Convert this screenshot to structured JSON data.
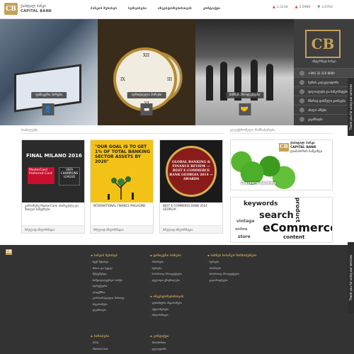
{
  "header": {
    "logo": {
      "mark": "CB",
      "line1": "ქაპიტალ ბანკი",
      "line2": "CAPITAL BANK"
    },
    "nav": [
      "ბანკის შესახებ",
      "სერვისები",
      "ინვესტორებისთვის",
      "კონტაქტი"
    ],
    "rates": [
      {
        "arrow": "▲",
        "dir": "up",
        "value": "2.3134"
      },
      {
        "arrow": "▲",
        "dir": "up",
        "value": "2.5989"
      },
      {
        "arrow": "▼",
        "dir": "down",
        "value": "3.0703"
      }
    ]
  },
  "hero": {
    "panels": [
      {
        "label": "ფიზიკური პირები",
        "icon": "👤"
      },
      {
        "label": "იურიდიული პირები",
        "icon": "▬"
      },
      {
        "label": "ბიზნეს პროდუქტები",
        "icon": "🤝"
      }
    ],
    "clock_numbers": [
      "XII",
      "III",
      "VI",
      "IX"
    ],
    "side": {
      "mark": "CB",
      "title": "ინტერნეტ ბანკი",
      "items": [
        "+995 32 210 8000",
        "სესხის კალკულატორი",
        "ფილიალები და ბანკომატები",
        "ხშირად დასმული კითხვები",
        "ახალი ამბები",
        "ვაკანსიები"
      ]
    }
  },
  "feedback": {
    "label": "Thank you for using our services",
    "top_label": "feedback"
  },
  "content": {
    "news_title": "სიახლეები",
    "partners_title": "ელექტრონული მომსახურება",
    "cards": [
      {
        "caption": "გამოიწერე MasterCard, ისარგებლე და მიიღეთ საჩუქრები",
        "more": "სრულად ინფორმაცია",
        "final_milano": "FINAL MILANO 2016",
        "mastercard": "MasterCard",
        "preferred": "Preferred Card",
        "champions": "UEFA CHAMPIONS LEAGUE"
      },
      {
        "caption": "INTERNATIONAL FINANCE MAGAZINE",
        "more": "სრულად ინფორმაცია",
        "quote": "\"OUR GOAL IS TO GET 1% OF TOTAL BANKING SECTOR ASSETS BY 2020\""
      },
      {
        "caption": "BEST E-COMMERCE BANK 2014 GEORGIA",
        "more": "სრულად ინფორმაცია",
        "seal": "GLOBAL BANKING & FINANCE REVIEW — BEST E-COMMERCE BANK GEORGIA 2014 — AWARDS"
      }
    ],
    "diaspora": {
      "mark": "CB",
      "brand1": "ქაპიტალ ბანკი",
      "brand2": "CAPITAL BANK",
      "brand3": "დიასპორის ბანკინგი",
      "label": "Diaspora Banking"
    },
    "ecommerce_words": [
      "keywords",
      "product",
      "search",
      "eCommerce",
      "content",
      "vintage",
      "online",
      "store"
    ]
  },
  "footer": {
    "logo": "CB",
    "columns": [
      {
        "title": "ბანკის შესახებ",
        "items": [
          "ჩვენ შესახებ",
          "მისია და ხედვა",
          "მენეჯმენტი",
          "სამეთვალყურეო საბჭო",
          "სტრუქტურა",
          "ლიცენზია",
          "კორპორაციული მართვა",
          "ანგარიშები",
          "ვაკანსიები"
        ]
      },
      {
        "title": "ფიზიკური პირები",
        "items": [
          "ანაბრები",
          "სესხები",
          "საბარათე პროდუქტები",
          "ფულადი გზავნილები"
        ]
      },
      {
        "title": "ბიზნეს საბანკო მომსახურება",
        "items": [
          "სესხები",
          "ანაბრები",
          "საბარათე პროდუქტები",
          "გადარიცხვები"
        ]
      },
      {
        "title": "ინვესტორებისთვის",
        "items": [
          "ფინანსური ანგარიშები",
          "აქციონერები",
          "ინფორმაცია"
        ]
      },
      {
        "title": "ბარათები",
        "items": [
          "VISA",
          "MasterCard"
        ]
      },
      {
        "title": "კონტაქტი",
        "items": [
          "მისამართი",
          "ტელეფონი"
        ]
      }
    ]
  }
}
